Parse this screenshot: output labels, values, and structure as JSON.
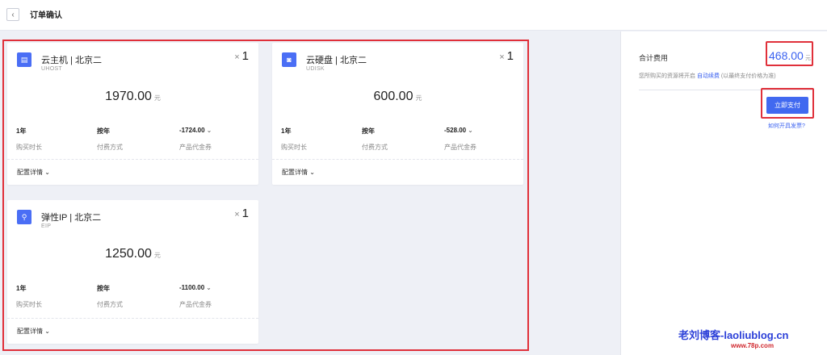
{
  "header": {
    "back_icon": "‹",
    "title": "订单确认"
  },
  "cards": [
    {
      "icon": "host-icon",
      "icon_glyph": "▤",
      "name": "云主机 | 北京二",
      "code": "UHOST",
      "qty_prefix": "×",
      "qty": "1",
      "price": "1970.00",
      "unit": "元",
      "duration": "1年",
      "duration_label": "购买时长",
      "pay_method": "按年",
      "pay_method_label": "付费方式",
      "coupon": "-1724.00",
      "coupon_label": "产品代金券",
      "detail": "配置详情"
    },
    {
      "icon": "disk-icon",
      "icon_glyph": "◙",
      "name": "云硬盘 | 北京二",
      "code": "UDISK",
      "qty_prefix": "×",
      "qty": "1",
      "price": "600.00",
      "unit": "元",
      "duration": "1年",
      "duration_label": "购买时长",
      "pay_method": "按年",
      "pay_method_label": "付费方式",
      "coupon": "-528.00",
      "coupon_label": "产品代金券",
      "detail": "配置详情"
    },
    {
      "icon": "eip-icon",
      "icon_glyph": "⚲",
      "name": "弹性IP | 北京二",
      "code": "EIP",
      "qty_prefix": "×",
      "qty": "1",
      "price": "1250.00",
      "unit": "元",
      "duration": "1年",
      "duration_label": "购买时长",
      "pay_method": "按年",
      "pay_method_label": "付费方式",
      "coupon": "-1100.00",
      "coupon_label": "产品代金券",
      "detail": "配置详情"
    }
  ],
  "summary": {
    "total_label": "合计费用",
    "total_amount": "468.00",
    "total_unit": "元",
    "renew_prefix": "您所购买的资源将开启",
    "renew_link": "自动续费",
    "renew_suffix": "(以最终支付价格为准)",
    "pay_button": "立即支付",
    "invoice_link": "如何开具发票?"
  },
  "watermark": {
    "line1": "老刘博客-laoliublog.cn",
    "line2": "www.78p.com"
  },
  "colors": {
    "accent": "#4169f0",
    "highlight": "#e0303a"
  }
}
